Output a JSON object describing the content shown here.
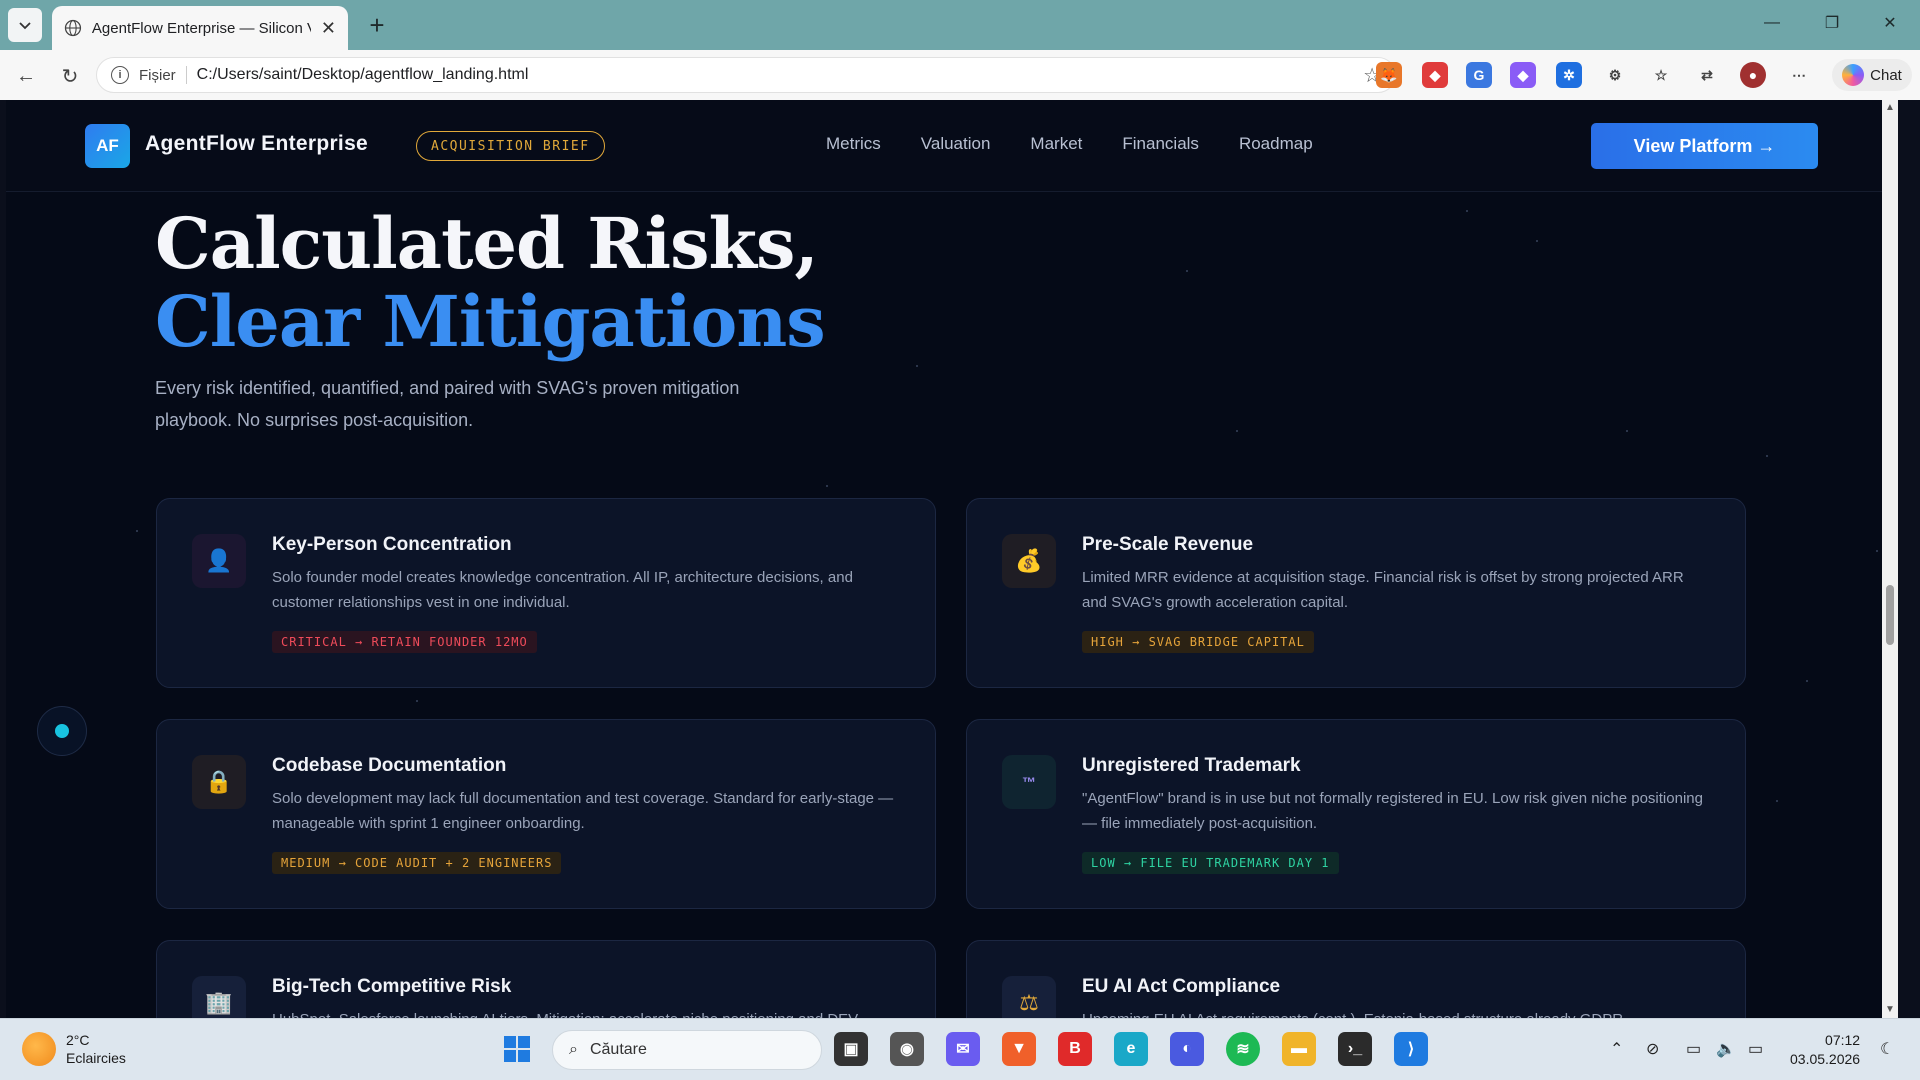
{
  "browser": {
    "tab_title": "AgentFlow Enterprise — Silicon Va",
    "scheme_label": "Fișier",
    "url": "C:/Users/saint/Desktop/agentflow_landing.html",
    "chat_label": "Chat"
  },
  "site": {
    "logo_initials": "AF",
    "brand_name": "AgentFlow Enterprise",
    "badge": "ACQUISITION BRIEF",
    "nav": [
      "Metrics",
      "Valuation",
      "Market",
      "Financials",
      "Roadmap"
    ],
    "cta": "View Platform →"
  },
  "hero": {
    "title_line1": "Calculated Risks,",
    "title_line2": "Clear Mitigations",
    "subtitle": "Every risk identified, quantified, and paired with SVAG's proven mitigation playbook. No surprises post-acquisition."
  },
  "risks": [
    {
      "title": "Key-Person Concentration",
      "description": "Solo founder model creates knowledge concentration. All IP, architecture decisions, and customer relationships vest in one individual.",
      "tag": "CRITICAL → RETAIN FOUNDER 12MO",
      "icon": "person-icon",
      "glyph": "👤",
      "level": "critical"
    },
    {
      "title": "Pre-Scale Revenue",
      "description": "Limited MRR evidence at acquisition stage. Financial risk is offset by strong projected ARR and SVAG's growth acceleration capital.",
      "tag": "HIGH → SVAG BRIDGE CAPITAL",
      "icon": "money-bag-icon",
      "glyph": "💰",
      "level": "high"
    },
    {
      "title": "Codebase Documentation",
      "description": "Solo development may lack full documentation and test coverage. Standard for early-stage — manageable with sprint 1 engineer onboarding.",
      "tag": "MEDIUM → CODE AUDIT + 2 ENGINEERS",
      "icon": "lock-icon",
      "glyph": "🔒",
      "level": "medium"
    },
    {
      "title": "Unregistered Trademark",
      "description": "\"AgentFlow\" brand is in use but not formally registered in EU. Low risk given niche positioning — file immediately post-acquisition.",
      "tag": "LOW → FILE EU TRADEMARK DAY 1",
      "icon": "trademark-icon",
      "glyph": "™",
      "level": "low"
    },
    {
      "title": "Big-Tech Competitive Risk",
      "description": "HubSpot, Salesforce launching AI tiers. Mitigation: accelerate niche positioning and DEV",
      "tag": "",
      "icon": "building-icon",
      "glyph": "🏢",
      "level": "high"
    },
    {
      "title": "EU AI Act Compliance",
      "description": "Upcoming EU AI Act requirements (cont.). Estonia-based structure already GDPR",
      "tag": "",
      "icon": "scales-icon",
      "glyph": "⚖",
      "level": "medium"
    }
  ],
  "taskbar": {
    "temperature": "2°C",
    "weather": "Eclaircies",
    "search_placeholder": "Căutare",
    "time": "07:12",
    "date": "03.05.2026"
  },
  "colors": {
    "accent": "#3a8ef2",
    "gold": "#e0a83a",
    "critical": "#ef4b5a",
    "low": "#2ed3a2"
  }
}
